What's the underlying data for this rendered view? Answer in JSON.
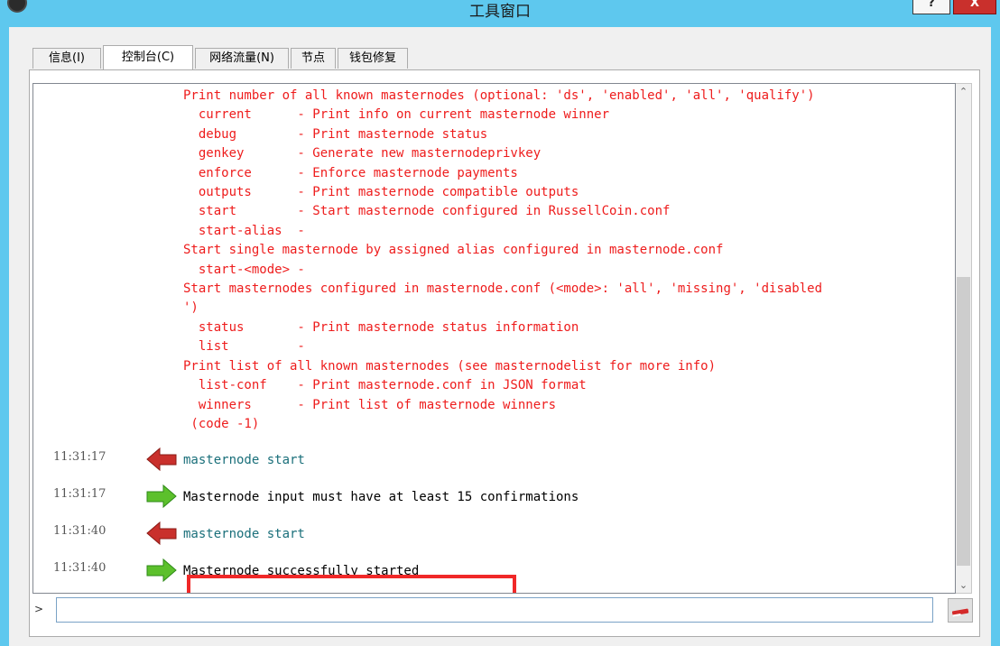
{
  "window": {
    "title": "工具窗口",
    "help_label": "?",
    "close_label": "X"
  },
  "tabs": [
    {
      "label": "信息(I)"
    },
    {
      "label": "控制台(C)"
    },
    {
      "label": "网络流量(N)"
    },
    {
      "label": "节点"
    },
    {
      "label": "钱包修复"
    }
  ],
  "console": {
    "help_text": "Print number of all known masternodes (optional: 'ds', 'enabled', 'all', 'qualify')\n  current      - Print info on current masternode winner\n  debug        - Print masternode status\n  genkey       - Generate new masternodeprivkey\n  enforce      - Enforce masternode payments\n  outputs      - Print masternode compatible outputs\n  start        - Start masternode configured in RussellCoin.conf\n  start-alias  -\nStart single masternode by assigned alias configured in masternode.conf\n  start-<mode> -\nStart masternodes configured in masternode.conf (<mode>: 'all', 'missing', 'disabled\n')\n  status       - Print masternode status information\n  list         -\nPrint list of all known masternodes (see masternodelist for more info)\n  list-conf    - Print masternode.conf in JSON format\n  winners      - Print list of masternode winners\n (code -1)",
    "messages": [
      {
        "time": "11:31:17",
        "kind": "command",
        "icon": "red-left-arrow-icon",
        "text": "masternode start"
      },
      {
        "time": "11:31:17",
        "kind": "reply",
        "icon": "green-right-arrow-icon",
        "text": "Masternode input must have at least 15 confirmations"
      },
      {
        "time": "11:31:40",
        "kind": "command",
        "icon": "red-left-arrow-icon",
        "text": "masternode start"
      },
      {
        "time": "11:31:40",
        "kind": "reply",
        "icon": "green-right-arrow-icon",
        "text": "Masternode successfully started"
      }
    ],
    "prompt": ">",
    "input_value": ""
  },
  "colors": {
    "title_bar": "#5ec8ee",
    "help_text": "#ee1c1c",
    "command_text": "#1a6f7a",
    "highlight": "#f02828",
    "command_arrow": "#c9302c",
    "reply_arrow": "#5cc02c"
  }
}
